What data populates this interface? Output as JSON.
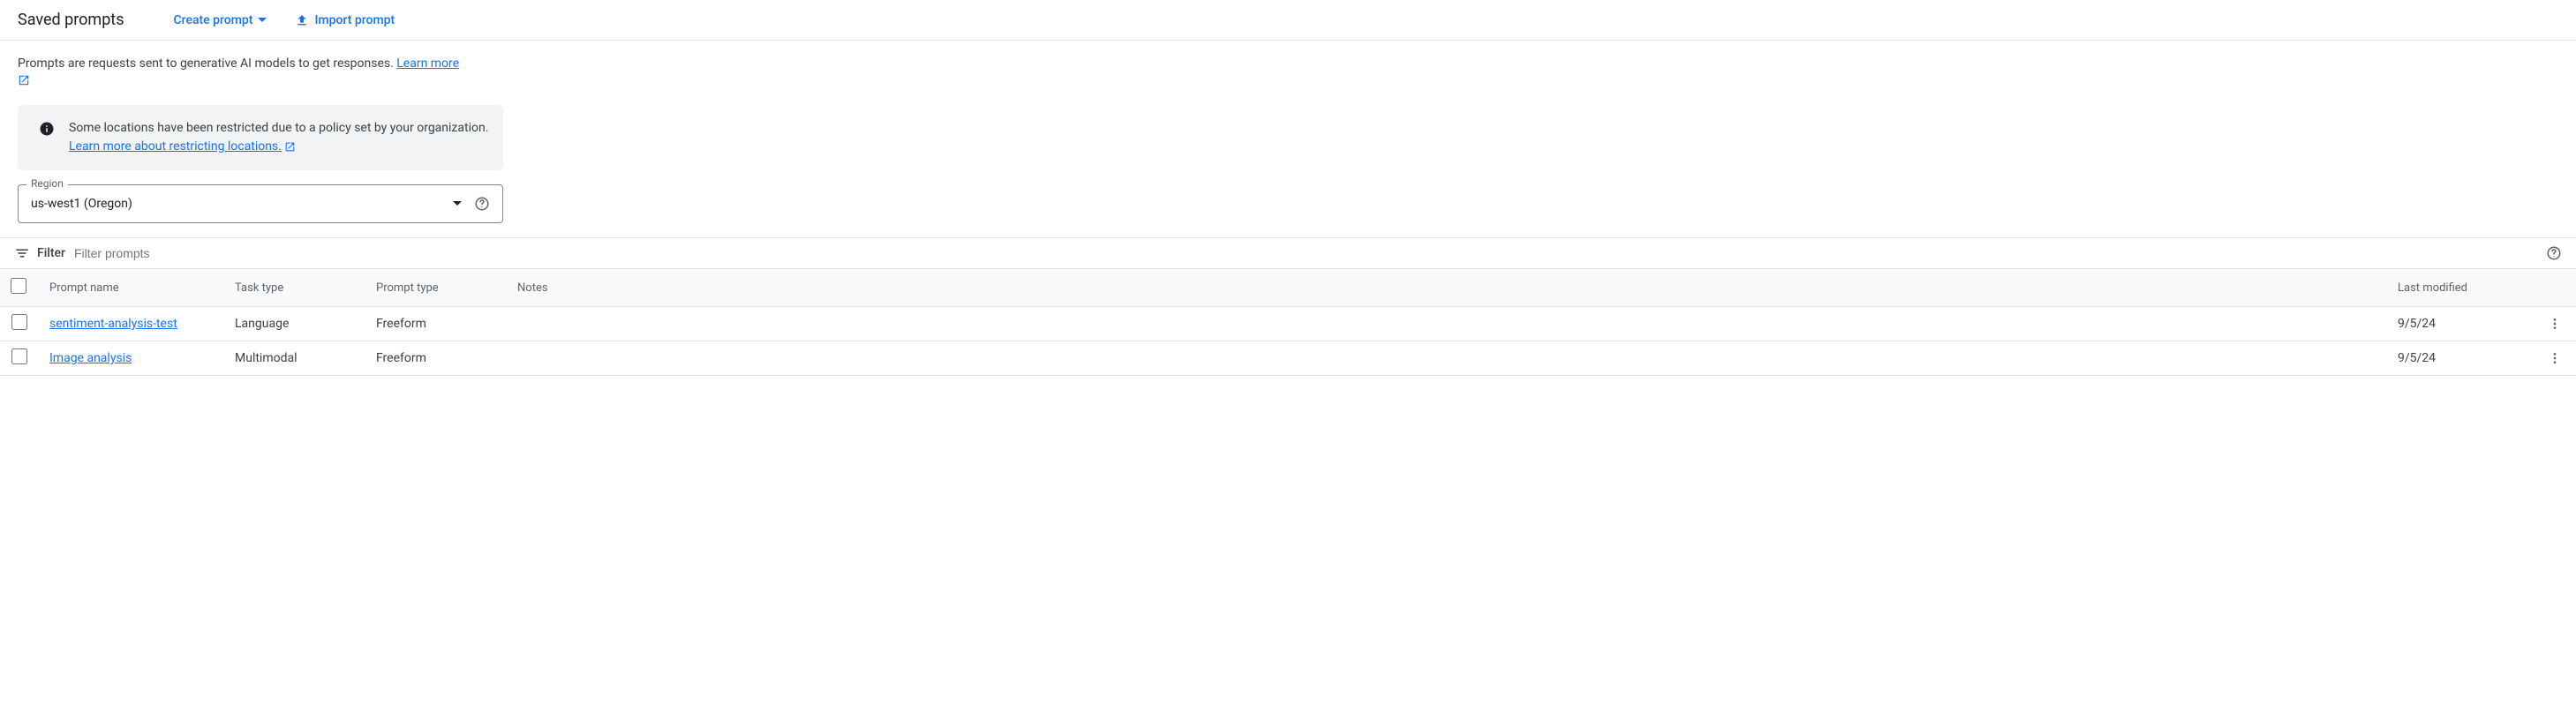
{
  "header": {
    "title": "Saved prompts",
    "create_label": "Create prompt",
    "import_label": "Import prompt"
  },
  "intro": {
    "text": "Prompts are requests sent to generative AI models to get responses. ",
    "learn_more": "Learn more"
  },
  "banner": {
    "text": "Some locations have been restricted due to a policy set by your organization. ",
    "link": "Learn more about restricting locations."
  },
  "region": {
    "label": "Region",
    "value": "us-west1 (Oregon)"
  },
  "filter": {
    "label": "Filter",
    "placeholder": "Filter prompts"
  },
  "table": {
    "headers": {
      "name": "Prompt name",
      "task": "Task type",
      "type": "Prompt type",
      "notes": "Notes",
      "modified": "Last modified"
    },
    "rows": [
      {
        "name": "sentiment-analysis-test",
        "task": "Language",
        "type": "Freeform",
        "notes": "",
        "modified": "9/5/24"
      },
      {
        "name": "Image analysis",
        "task": "Multimodal",
        "type": "Freeform",
        "notes": "",
        "modified": "9/5/24"
      }
    ]
  }
}
